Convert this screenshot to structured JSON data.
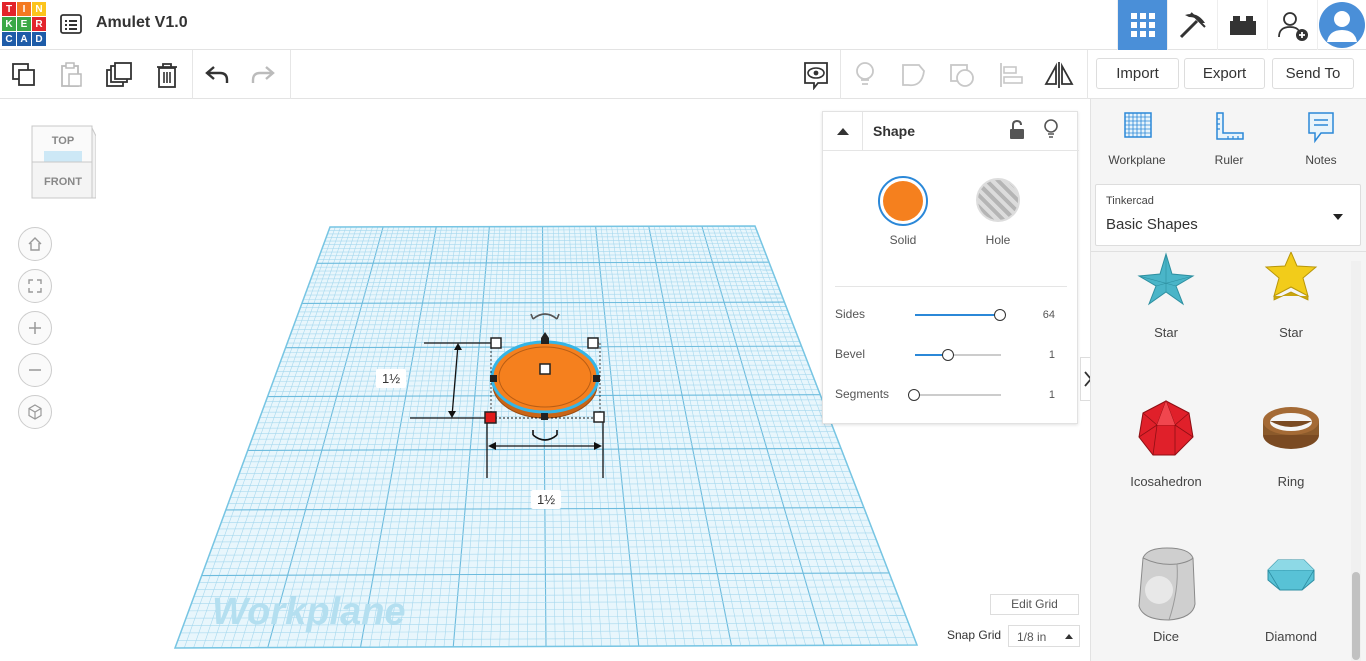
{
  "app": {
    "logo_letters": [
      "T",
      "I",
      "N",
      "K",
      "E",
      "R",
      "C",
      "A",
      "D"
    ],
    "logo_colors": [
      "#e2242b",
      "#f47921",
      "#fcc41c",
      "#3aa846",
      "#3aa846",
      "#e2242b",
      "#1e5ca8",
      "#1e5ca8",
      "#1e5ca8"
    ],
    "title": "Amulet V1.0",
    "accent": "#4a8fd8"
  },
  "topbar": {
    "icons": [
      "grid-view-icon",
      "pickaxe-icon",
      "bricks-icon",
      "add-user-icon",
      "avatar"
    ]
  },
  "toolbar": {
    "import_label": "Import",
    "export_label": "Export",
    "send_to_label": "Send To"
  },
  "viewcube": {
    "top": "TOP",
    "front": "FRONT"
  },
  "workspace": {
    "workplane_label": "Workplane",
    "dim_height": "1½",
    "dim_width": "1½",
    "edit_grid_label": "Edit Grid",
    "snap_grid_label": "Snap Grid",
    "snap_grid_value": "1/8 in"
  },
  "shape_panel": {
    "title": "Shape",
    "solid_label": "Solid",
    "hole_label": "Hole",
    "solid_color": "#f5801e",
    "params": [
      {
        "label": "Sides",
        "value": "64",
        "fraction": 1.0
      },
      {
        "label": "Bevel",
        "value": "1",
        "fraction": 0.37
      },
      {
        "label": "Segments",
        "value": "1",
        "fraction": 0.0
      }
    ]
  },
  "side": {
    "tools": [
      {
        "label": "Workplane",
        "icon": "workplane-icon"
      },
      {
        "label": "Ruler",
        "icon": "ruler-icon"
      },
      {
        "label": "Notes",
        "icon": "notes-icon"
      }
    ],
    "library_category": "Tinkercad",
    "library_name": "Basic Shapes",
    "shapes": [
      {
        "label": "Star",
        "color": "#4ab5c8"
      },
      {
        "label": "Star",
        "color": "#f2cc1a"
      },
      {
        "label": "Icosahedron",
        "color": "#e0202a"
      },
      {
        "label": "Ring",
        "color": "#8b5a2b"
      },
      {
        "label": "Dice",
        "color": "#cfcfcf"
      },
      {
        "label": "Diamond",
        "color": "#58c2d6"
      }
    ]
  }
}
